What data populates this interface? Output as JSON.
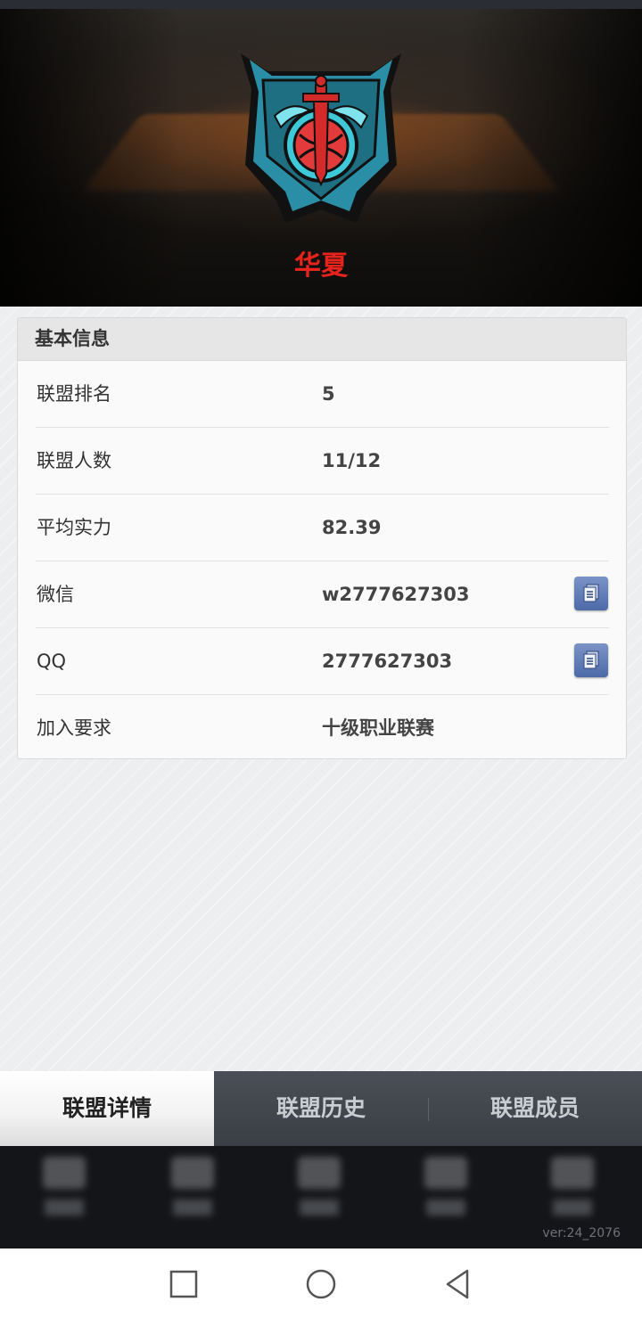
{
  "team": {
    "name": "华夏",
    "emblem_icon": "team-emblem-sword-shield"
  },
  "basic_info": {
    "title": "基本信息",
    "rows": [
      {
        "label": "联盟排名",
        "value": "5"
      },
      {
        "label": "联盟人数",
        "value": "11/12"
      },
      {
        "label": "平均实力",
        "value": "82.39"
      },
      {
        "label": "微信",
        "value": "w2777627303",
        "copy_icon": "copy-icon"
      },
      {
        "label": "QQ",
        "value": "2777627303",
        "copy_icon": "copy-icon"
      },
      {
        "label": "加入要求",
        "value": "十级职业联赛"
      }
    ]
  },
  "tabs": [
    {
      "label": "联盟详情",
      "active": true
    },
    {
      "label": "联盟历史",
      "active": false
    },
    {
      "label": "联盟成员",
      "active": false
    }
  ],
  "footer": {
    "version": "ver:24_2076"
  },
  "colors": {
    "team_name": "#e8231c",
    "copy_button": "#5a75b2",
    "tab_bar": "#41454c"
  }
}
